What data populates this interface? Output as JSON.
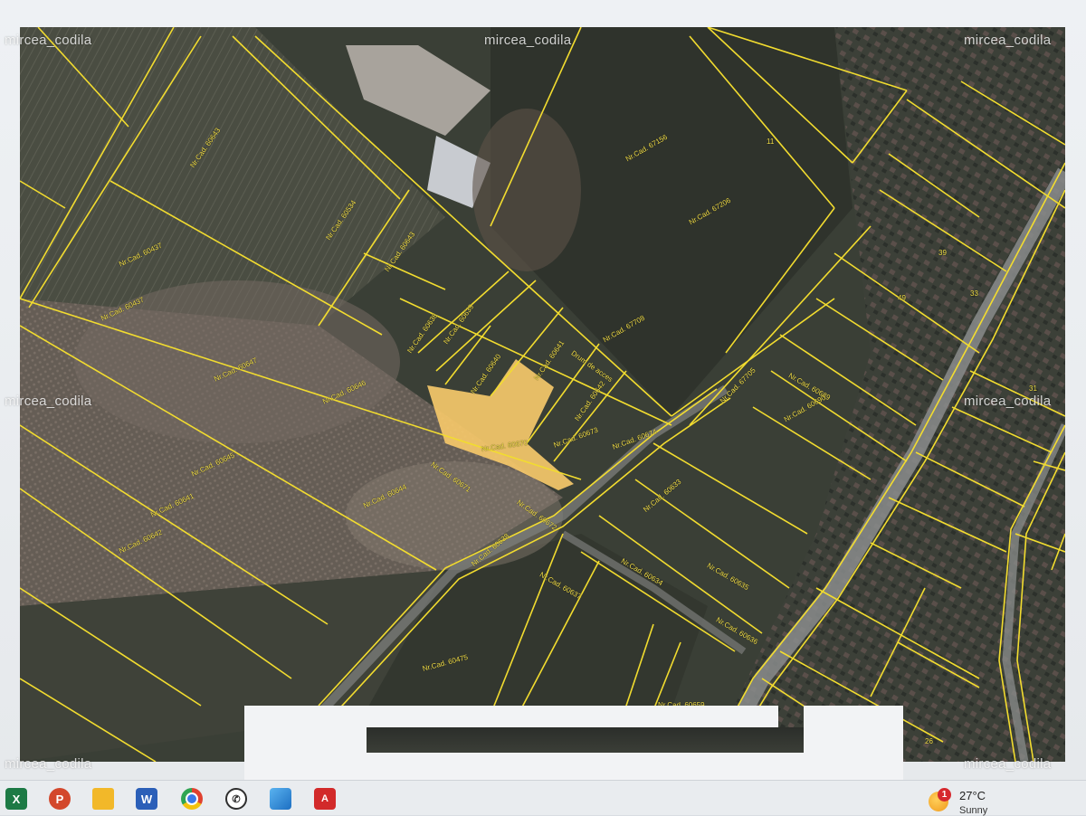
{
  "watermarks": [
    "mircea_codila",
    "mircea_codila",
    "mircea_codila",
    "mircea_codila",
    "mircea_codila",
    "mircea_codila",
    "mircea_codila"
  ],
  "colors": {
    "parcel_outline": "#f2dc2f",
    "highlight_parcel": "#f5c86a",
    "ground_dark": "#3a3f36"
  },
  "taskbar": {
    "apps": [
      {
        "name": "excel-icon",
        "glyph": "X",
        "color": "#1d7a45"
      },
      {
        "name": "powerpoint-icon",
        "glyph": "P",
        "color": "#d3472b"
      },
      {
        "name": "file-explorer-icon",
        "glyph": "",
        "color": "#f2b829"
      },
      {
        "name": "word-icon",
        "glyph": "W",
        "color": "#2b5fb8"
      },
      {
        "name": "chrome-icon",
        "glyph": "",
        "color": "#e0412f"
      },
      {
        "name": "whatsapp-icon",
        "glyph": "",
        "color": "#2f2f2f"
      },
      {
        "name": "photos-icon",
        "glyph": "",
        "color": "#2f8fd6"
      },
      {
        "name": "acrobat-icon",
        "glyph": "",
        "color": "#d22a2a"
      }
    ],
    "weather": {
      "badge": "1",
      "temperature": "27°C",
      "condition": "Sunny"
    }
  }
}
